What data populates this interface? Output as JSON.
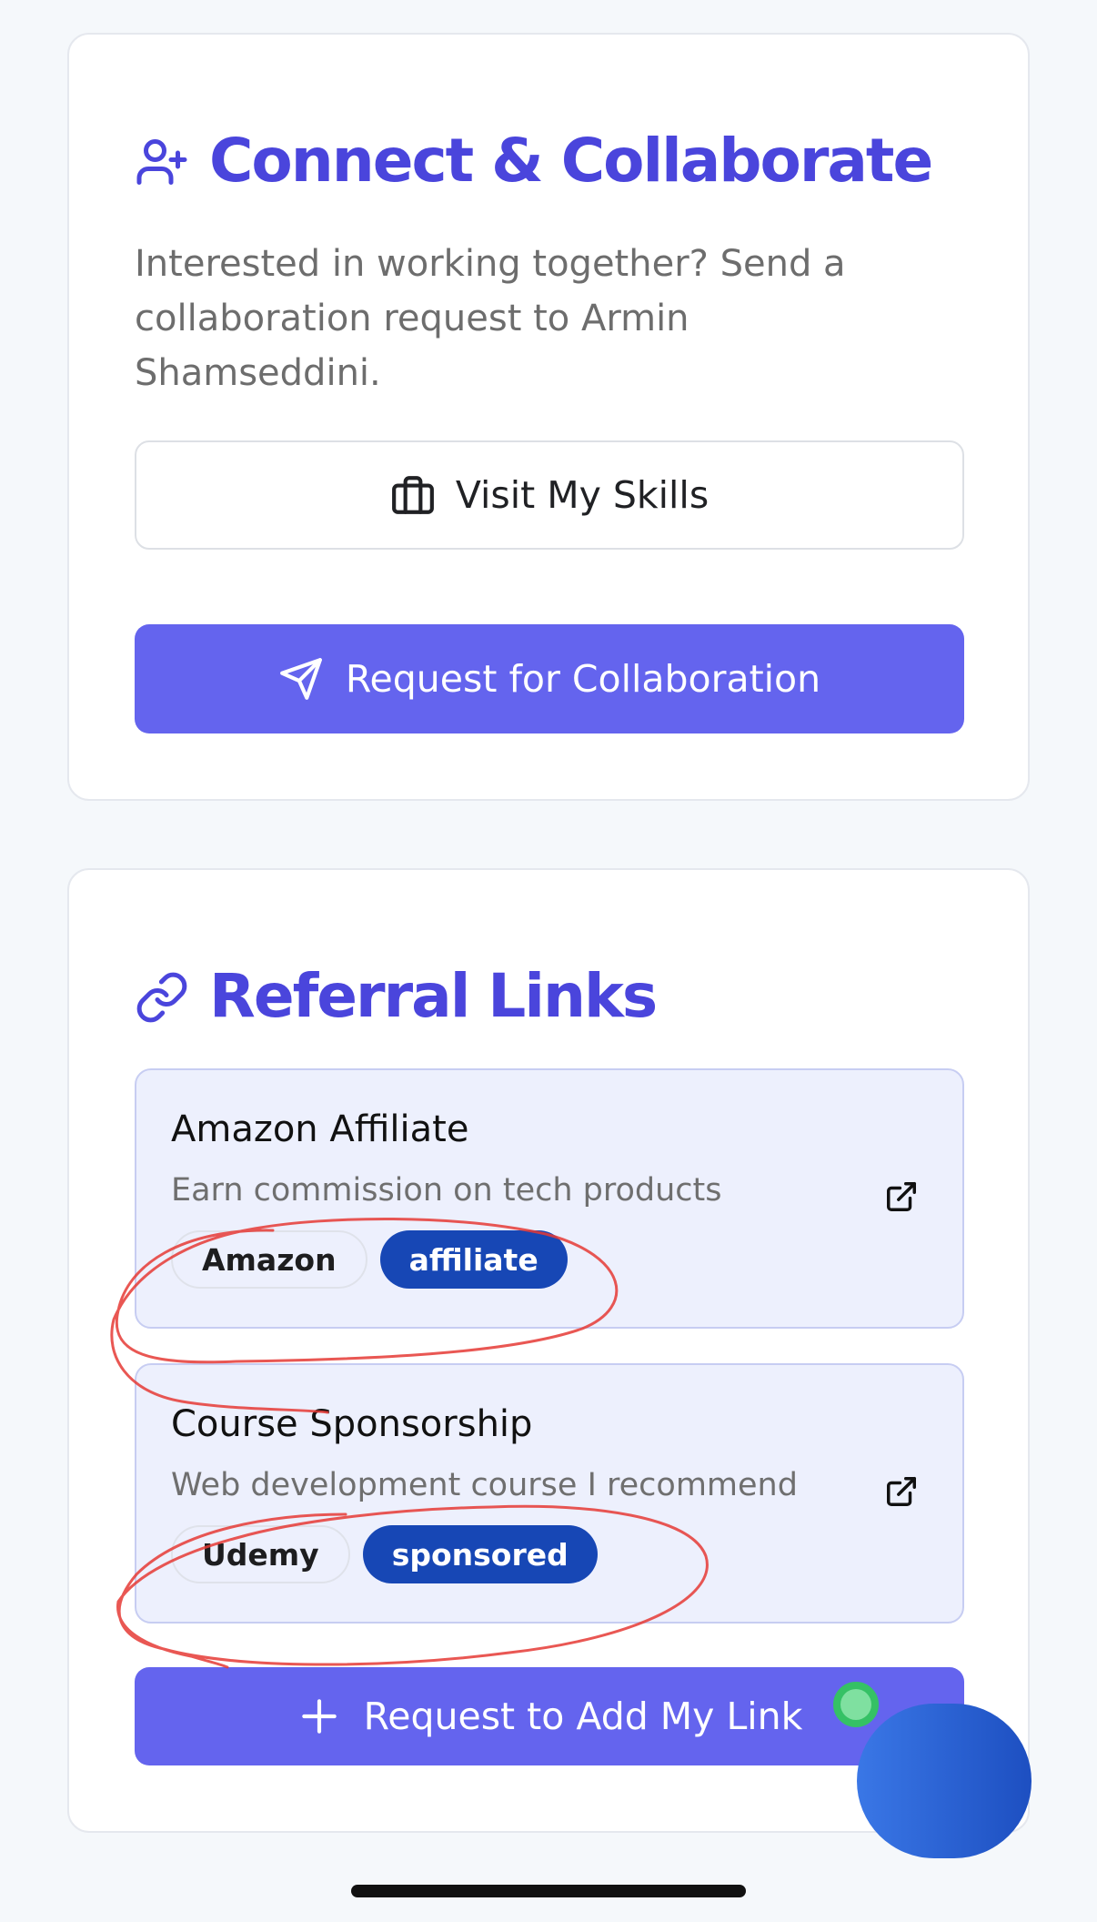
{
  "connect": {
    "title": "Connect & Collaborate",
    "title_icon": "user-plus-icon",
    "description": "Interested in working together? Send a collaboration request to Armin Shamseddini.",
    "skills_button": {
      "label": "Visit My Skills",
      "icon": "briefcase-icon"
    },
    "collab_button": {
      "label": "Request for Collaboration",
      "icon": "send-icon"
    }
  },
  "referral": {
    "title": "Referral Links",
    "title_icon": "link-icon",
    "items": [
      {
        "title": "Amazon Affiliate",
        "description": "Earn commission on tech products",
        "platform": "Amazon",
        "type": "affiliate",
        "icon": "external-link-icon"
      },
      {
        "title": "Course Sponsorship",
        "description": "Web development course I recommend",
        "platform": "Udemy",
        "type": "sponsored",
        "icon": "external-link-icon"
      }
    ],
    "add_link_button": {
      "label": "Request to Add My Link",
      "icon": "plus-icon"
    }
  },
  "colors": {
    "accent": "#4a45dc",
    "primary_button": "#6464ee",
    "tag_type": "#1747b5",
    "annotation": "#e53935",
    "online_dot": "#35c165"
  }
}
